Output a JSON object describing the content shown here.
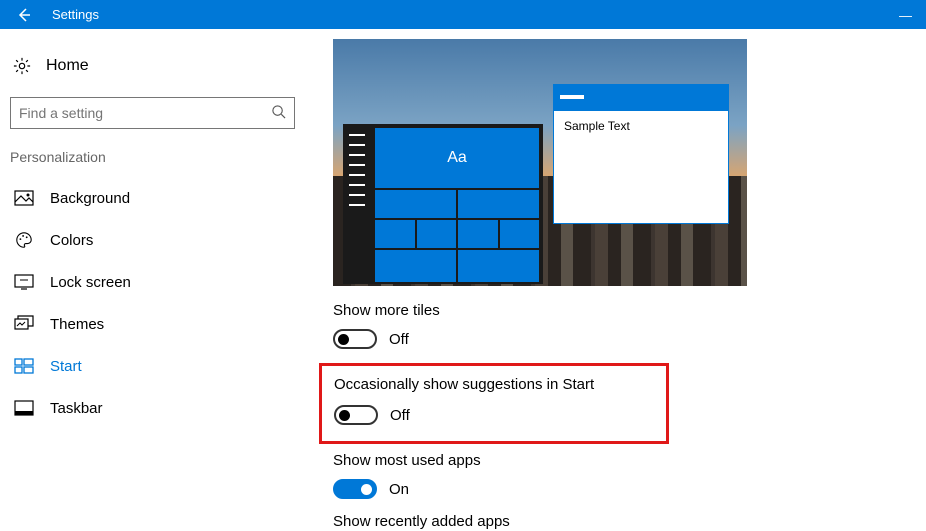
{
  "titlebar": {
    "title": "Settings"
  },
  "sidebar": {
    "home": "Home",
    "searchPlaceholder": "Find a setting",
    "category": "Personalization",
    "items": [
      {
        "label": "Background"
      },
      {
        "label": "Colors"
      },
      {
        "label": "Lock screen"
      },
      {
        "label": "Themes"
      },
      {
        "label": "Start"
      },
      {
        "label": "Taskbar"
      }
    ]
  },
  "preview": {
    "tileText": "Aa",
    "sampleWindowText": "Sample Text"
  },
  "settings": {
    "showMoreTiles": {
      "label": "Show more tiles",
      "state": "Off"
    },
    "suggestions": {
      "label": "Occasionally show suggestions in Start",
      "state": "Off"
    },
    "mostUsed": {
      "label": "Show most used apps",
      "state": "On"
    },
    "recentlyAdded": {
      "label": "Show recently added apps"
    }
  }
}
